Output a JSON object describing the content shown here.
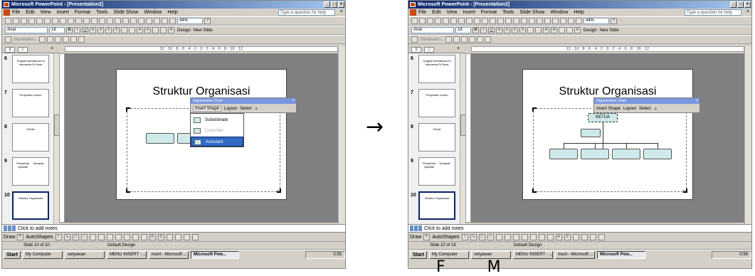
{
  "left": {
    "window_title": "Microsoft PowerPoint - [Presentation2]",
    "task_active": "Microsoft Pow...",
    "tray_time": "0:55",
    "slide_status": "Slide 10 of 10",
    "menu_items": [
      "Subordinate",
      "Coworker",
      "Assistant"
    ]
  },
  "right": {
    "window_title": "Microsoft PowerPoint - [Presentation2]",
    "task_active": "Microsoft Pow...",
    "tray_time": "0:56",
    "slide_status": "Slide 10 of 19",
    "root_box": "KETUA"
  },
  "common": {
    "menus": [
      "File",
      "Edit",
      "View",
      "Insert",
      "Format",
      "Tools",
      "Slide Show",
      "Window",
      "Help"
    ],
    "ask": "Type a question for help",
    "font": "Arial",
    "size": "18",
    "zoom": "44%",
    "design": "Design",
    "new_slide": "New Slide",
    "reviewers": "Reviewers...",
    "ruler": "12 · 10 · 8 · 6 · 4 · 2 · 0 · 2 · 4 · 6 · 8 · 10 · 12",
    "slide_title": "Struktur Organisasi",
    "slide_number": "10",
    "org_title": "Organization Chart",
    "insert_shape": "Insert Shape",
    "layout": "Layout",
    "select": "Select",
    "notes": "Click to add notes",
    "draw": "Draw",
    "autoshapes": "AutoShapes",
    "design_name": "Default Design",
    "start": "Start",
    "tasks": [
      "My Computer",
      "setyawan",
      "MENU INSERT - ...",
      "nsert - Microsoft ..."
    ],
    "thumb_numbers": [
      "6",
      "7",
      "8",
      "9",
      "10"
    ],
    "thumb5_text": "Tingkat Kemiskinan Di Indonesia Di Desa",
    "thumb7_text": "Penyebab Umum",
    "thumb8_text": "Solusi",
    "thumb9_left": "Penyebab Spesifik",
    "thumb9_right": "Dampak",
    "thumb10_text": "Struktur Organisasi"
  },
  "arrow": "→",
  "caption": "F  M"
}
